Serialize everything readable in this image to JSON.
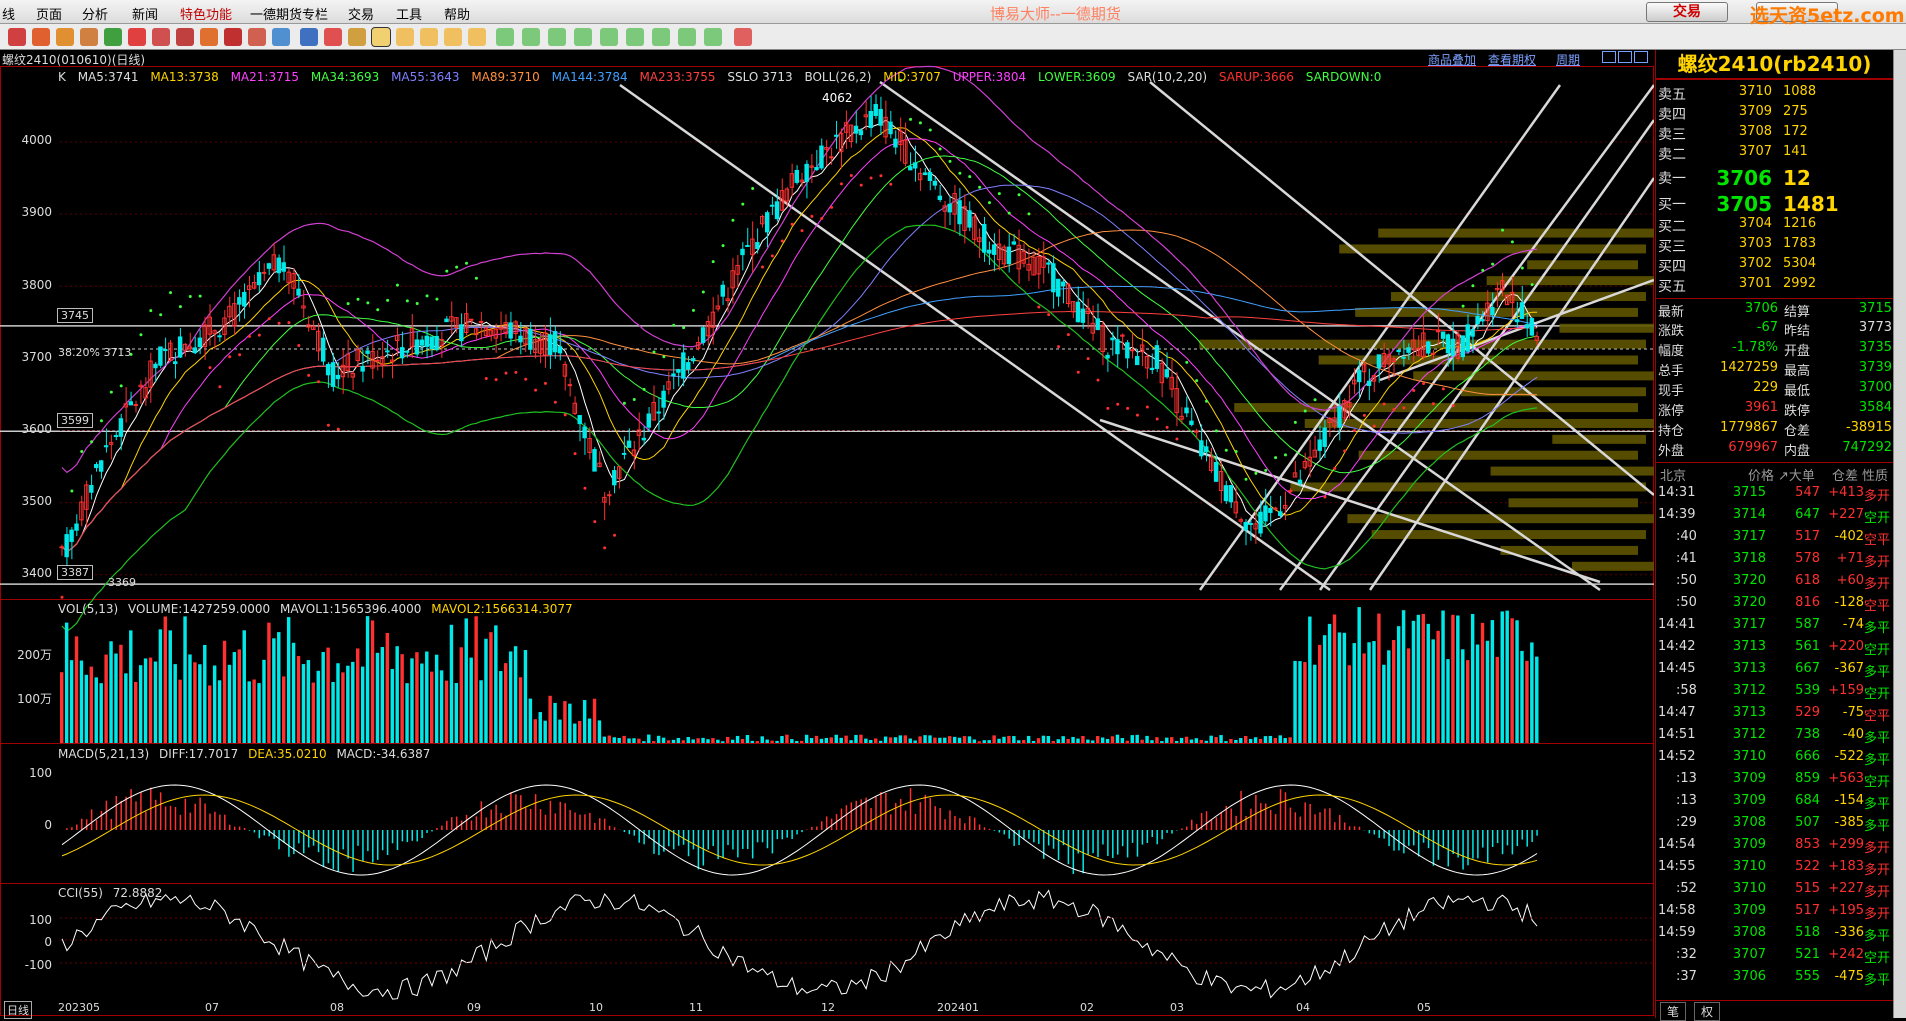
{
  "menu": [
    "线",
    "页面",
    "分析",
    "新闻",
    "特色功能",
    "一德期货专栏",
    "交易",
    "工具",
    "帮助"
  ],
  "app_title": "博易大师--一德期货",
  "trade_button": "交易",
  "watermark": "选天资5etz.com",
  "chart_title": "螺纹2410(010610)(日线)",
  "top_links": [
    "商品叠加",
    "查看期权",
    "周期"
  ],
  "main_legend": {
    "k": "K",
    "ma5": "MA5:3741",
    "ma13": "MA13:3738",
    "ma21": "MA21:3715",
    "ma34": "MA34:3693",
    "ma55": "MA55:3643",
    "ma89": "MA89:3710",
    "ma144": "MA144:3784",
    "ma233": "MA233:3755",
    "sslo": "SSLO 3713",
    "boll": "BOLL(26,2)",
    "mid": "MID:3707",
    "upper": "UPPER:3804",
    "lower": "LOWER:3609",
    "sar": "SAR(10,2,20)",
    "sarup": "SARUP:3666",
    "sardown": "SARDOWN:0"
  },
  "main_axis": [
    "4000",
    "3900",
    "3800",
    "3700",
    "3600",
    "3500",
    "3400"
  ],
  "price_marks": {
    "high": "4062",
    "box1": "3745",
    "box2": "3599",
    "box3": "3387",
    "fib": "38.20% 3713",
    "low": "3369"
  },
  "vol_legend": {
    "vol": "VOL(5,13)",
    "volume": "VOLUME:1427259.0000",
    "mavol1": "MAVOL1:1565396.4000",
    "mavol2": "MAVOL2:1566314.3077"
  },
  "vol_axis": [
    "200万",
    "100万"
  ],
  "macd_legend": {
    "macd": "MACD(5,21,13)",
    "diff": "DIFF:17.7017",
    "dea": "DEA:35.0210",
    "macdv": "MACD:-34.6387"
  },
  "macd_axis": [
    "100",
    "0"
  ],
  "cci_legend": {
    "cci": "CCI(55)",
    "val": "72.8882"
  },
  "cci_axis": [
    "100",
    "0",
    "-100"
  ],
  "x_axis": {
    "period": "日线",
    "labels": [
      "202305",
      "07",
      "08",
      "09",
      "10",
      "11",
      "12",
      "202401",
      "02",
      "03",
      "04",
      "05"
    ]
  },
  "panel": {
    "title": "螺纹2410(rb2410)",
    "asks": [
      {
        "l": "卖五",
        "p": "3710",
        "v": "1088"
      },
      {
        "l": "卖四",
        "p": "3709",
        "v": "275"
      },
      {
        "l": "卖三",
        "p": "3708",
        "v": "172"
      },
      {
        "l": "卖二",
        "p": "3707",
        "v": "141"
      },
      {
        "l": "卖一",
        "p": "3706",
        "v": "12"
      }
    ],
    "bids": [
      {
        "l": "买一",
        "p": "3705",
        "v": "1481"
      },
      {
        "l": "买二",
        "p": "3704",
        "v": "1216"
      },
      {
        "l": "买三",
        "p": "3703",
        "v": "1783"
      },
      {
        "l": "买四",
        "p": "3702",
        "v": "5304"
      },
      {
        "l": "买五",
        "p": "3701",
        "v": "2992"
      }
    ],
    "info": [
      {
        "a": "最新",
        "b": "3706",
        "bc": "#00e400",
        "c": "结算",
        "d": "3715",
        "dc": "#00e400"
      },
      {
        "a": "涨跌",
        "b": "-67",
        "bc": "#00e400",
        "c": "昨结",
        "d": "3773",
        "dc": "#ddd"
      },
      {
        "a": "幅度",
        "b": "-1.78%",
        "bc": "#00e400",
        "c": "开盘",
        "d": "3735",
        "dc": "#00e400"
      },
      {
        "a": "总手",
        "b": "1427259",
        "bc": "#ffd400",
        "c": "最高",
        "d": "3739",
        "dc": "#00e400"
      },
      {
        "a": "现手",
        "b": "229",
        "bc": "#ffd400",
        "c": "最低",
        "d": "3700",
        "dc": "#00e400"
      },
      {
        "a": "涨停",
        "b": "3961",
        "bc": "#ff3030",
        "c": "跌停",
        "d": "3584",
        "dc": "#00e400"
      },
      {
        "a": "持仓",
        "b": "1779867",
        "bc": "#ffd400",
        "c": "仓差",
        "d": "-38915",
        "dc": "#ffd400"
      },
      {
        "a": "外盘",
        "b": "679967",
        "bc": "#ff3030",
        "c": "内盘",
        "d": "747292",
        "dc": "#00e400"
      }
    ],
    "ticks_header": {
      "loc": "北京",
      "price": "价格",
      "vol": "↗大单",
      "diff": "仓差",
      "prop": "性质"
    },
    "ticks": [
      {
        "t": "14:31",
        "p": "3715",
        "pc": "#00e400",
        "v": "547",
        "vc": "#ff3030",
        "d": "+413",
        "s": "多开",
        "sc": "#ff3030"
      },
      {
        "t": "14:39",
        "p": "3714",
        "pc": "#00e400",
        "v": "647",
        "vc": "#00e400",
        "d": "+227",
        "s": "空开",
        "sc": "#00e400"
      },
      {
        "t": ":40",
        "p": "3717",
        "pc": "#00e400",
        "v": "517",
        "vc": "#ff3030",
        "d": "-402",
        "s": "空平",
        "sc": "#ff3030"
      },
      {
        "t": ":41",
        "p": "3718",
        "pc": "#00e400",
        "v": "578",
        "vc": "#ff3030",
        "d": "+71",
        "s": "多开",
        "sc": "#ff3030"
      },
      {
        "t": ":50",
        "p": "3720",
        "pc": "#00e400",
        "v": "618",
        "vc": "#ff3030",
        "d": "+60",
        "s": "多开",
        "sc": "#ff3030"
      },
      {
        "t": ":50",
        "p": "3720",
        "pc": "#00e400",
        "v": "816",
        "vc": "#ff3030",
        "d": "-128",
        "s": "空平",
        "sc": "#ff3030"
      },
      {
        "t": "14:41",
        "p": "3717",
        "pc": "#00e400",
        "v": "587",
        "vc": "#00e400",
        "d": "-74",
        "s": "多平",
        "sc": "#00e400"
      },
      {
        "t": "14:42",
        "p": "3713",
        "pc": "#00e400",
        "v": "561",
        "vc": "#00e400",
        "d": "+220",
        "s": "空开",
        "sc": "#00e400"
      },
      {
        "t": "14:45",
        "p": "3713",
        "pc": "#00e400",
        "v": "667",
        "vc": "#00e400",
        "d": "-367",
        "s": "多平",
        "sc": "#00e400"
      },
      {
        "t": ":58",
        "p": "3712",
        "pc": "#00e400",
        "v": "539",
        "vc": "#00e400",
        "d": "+159",
        "s": "空开",
        "sc": "#00e400"
      },
      {
        "t": "14:47",
        "p": "3713",
        "pc": "#00e400",
        "v": "529",
        "vc": "#ff3030",
        "d": "-75",
        "s": "空平",
        "sc": "#ff3030"
      },
      {
        "t": "14:51",
        "p": "3712",
        "pc": "#00e400",
        "v": "738",
        "vc": "#00e400",
        "d": "-40",
        "s": "多平",
        "sc": "#00e400"
      },
      {
        "t": "14:52",
        "p": "3710",
        "pc": "#00e400",
        "v": "666",
        "vc": "#00e400",
        "d": "-522",
        "s": "多平",
        "sc": "#00e400"
      },
      {
        "t": ":13",
        "p": "3709",
        "pc": "#00e400",
        "v": "859",
        "vc": "#00e400",
        "d": "+563",
        "s": "空开",
        "sc": "#00e400"
      },
      {
        "t": ":13",
        "p": "3709",
        "pc": "#00e400",
        "v": "684",
        "vc": "#00e400",
        "d": "-154",
        "s": "多平",
        "sc": "#00e400"
      },
      {
        "t": ":29",
        "p": "3708",
        "pc": "#00e400",
        "v": "507",
        "vc": "#00e400",
        "d": "-385",
        "s": "多平",
        "sc": "#00e400"
      },
      {
        "t": "14:54",
        "p": "3709",
        "pc": "#00e400",
        "v": "853",
        "vc": "#ff3030",
        "d": "+299",
        "s": "多开",
        "sc": "#ff3030"
      },
      {
        "t": "14:55",
        "p": "3710",
        "pc": "#00e400",
        "v": "522",
        "vc": "#ff3030",
        "d": "+183",
        "s": "多开",
        "sc": "#ff3030"
      },
      {
        "t": ":52",
        "p": "3710",
        "pc": "#00e400",
        "v": "515",
        "vc": "#ff3030",
        "d": "+227",
        "s": "多开",
        "sc": "#ff3030"
      },
      {
        "t": "14:58",
        "p": "3709",
        "pc": "#00e400",
        "v": "517",
        "vc": "#ff3030",
        "d": "+195",
        "s": "多开",
        "sc": "#ff3030"
      },
      {
        "t": "14:59",
        "p": "3708",
        "pc": "#00e400",
        "v": "518",
        "vc": "#00e400",
        "d": "-336",
        "s": "多平",
        "sc": "#00e400"
      },
      {
        "t": ":32",
        "p": "3707",
        "pc": "#00e400",
        "v": "521",
        "vc": "#00e400",
        "d": "+242",
        "s": "空开",
        "sc": "#00e400"
      },
      {
        "t": ":37",
        "p": "3706",
        "pc": "#00e400",
        "v": "555",
        "vc": "#00e400",
        "d": "-475",
        "s": "多平",
        "sc": "#00e400"
      }
    ],
    "bottom_tabs": [
      "笔",
      "权"
    ]
  },
  "colors": {
    "up": "#ff3030",
    "down": "#00e8e8",
    "frame": "#a00000",
    "accent": "#ffd400"
  }
}
